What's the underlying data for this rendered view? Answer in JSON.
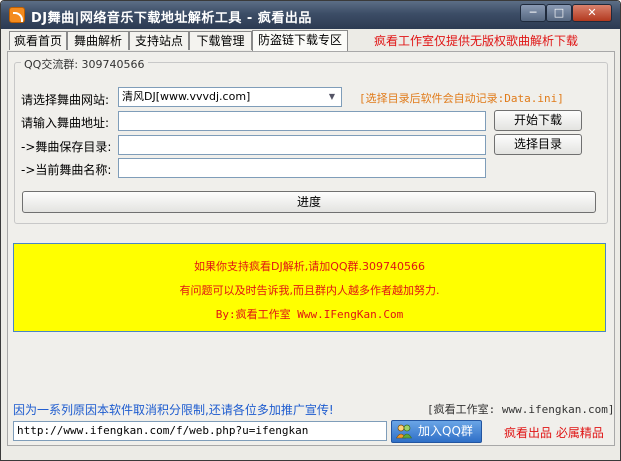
{
  "window": {
    "title": "DJ舞曲|网络音乐下载地址解析工具 - 疯看出品",
    "min_label": "─",
    "max_label": "□",
    "close_label": "✕"
  },
  "tabs": [
    {
      "label": "疯看首页"
    },
    {
      "label": "舞曲解析"
    },
    {
      "label": "支持站点"
    },
    {
      "label": "下载管理"
    },
    {
      "label": "防盗链下载专区"
    }
  ],
  "promo_top": "疯看工作室仅提供无版权歌曲解析下载",
  "group": {
    "title": "QQ交流群: 309740566"
  },
  "form": {
    "site_label": "请选择舞曲网站:",
    "site_value": "清风DJ[www.vvvdj.com]",
    "hint": "[选择目录后软件会自动记录:Data.ini]",
    "url_label": "请输入舞曲地址:",
    "url_value": "",
    "save_dir_label": "->舞曲保存目录:",
    "save_dir_value": "",
    "current_name_label": "->当前舞曲名称:",
    "current_name_value": "",
    "start_download": "开始下载",
    "choose_dir": "选择目录",
    "progress_label": "进度"
  },
  "notice": {
    "line1": "如果你支持疯看DJ解析,请加QQ群.309740566",
    "line2": "有问题可以及时告诉我,而且群内人越多作者越加努力.",
    "line3": "By:疯看工作室 Www.IFengKan.Com"
  },
  "footer": {
    "note": "因为一系列原因本软件取消积分限制,还请各位多加推广宣传!",
    "studio": "[疯看工作室: www.ifengkan.com]",
    "url": "http://www.ifengkan.com/f/web.php?u=ifengkan",
    "qq_button": "加入QQ群",
    "slogan": "疯看出品 必属精品"
  },
  "colors": {
    "accent_red": "#e01414",
    "hint_orange": "#e07b1a",
    "link_blue": "#1e5ccf",
    "notice_bg": "#ffff00"
  }
}
